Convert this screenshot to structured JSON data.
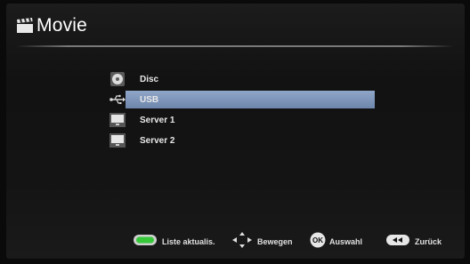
{
  "header": {
    "title": "Movie",
    "icon": "clapperboard-icon"
  },
  "sources": [
    {
      "label": "Disc",
      "icon": "disc-icon",
      "selected": false
    },
    {
      "label": "USB",
      "icon": "usb-icon",
      "selected": true
    },
    {
      "label": "Server 1",
      "icon": "server-icon",
      "selected": false
    },
    {
      "label": "Server 2",
      "icon": "server-icon",
      "selected": false
    }
  ],
  "footer": {
    "refresh": {
      "label": "Liste aktualis.",
      "icon": "green-button-icon"
    },
    "move": {
      "label": "Bewegen",
      "icon": "directional-pad-icon"
    },
    "select": {
      "label": "Auswahl",
      "icon": "ok-button-icon",
      "icon_text": "OK"
    },
    "back": {
      "label": "Zurück",
      "icon": "rewind-button-icon"
    }
  },
  "colors": {
    "selection": "#7f97bd",
    "green_key": "#37c83a"
  }
}
